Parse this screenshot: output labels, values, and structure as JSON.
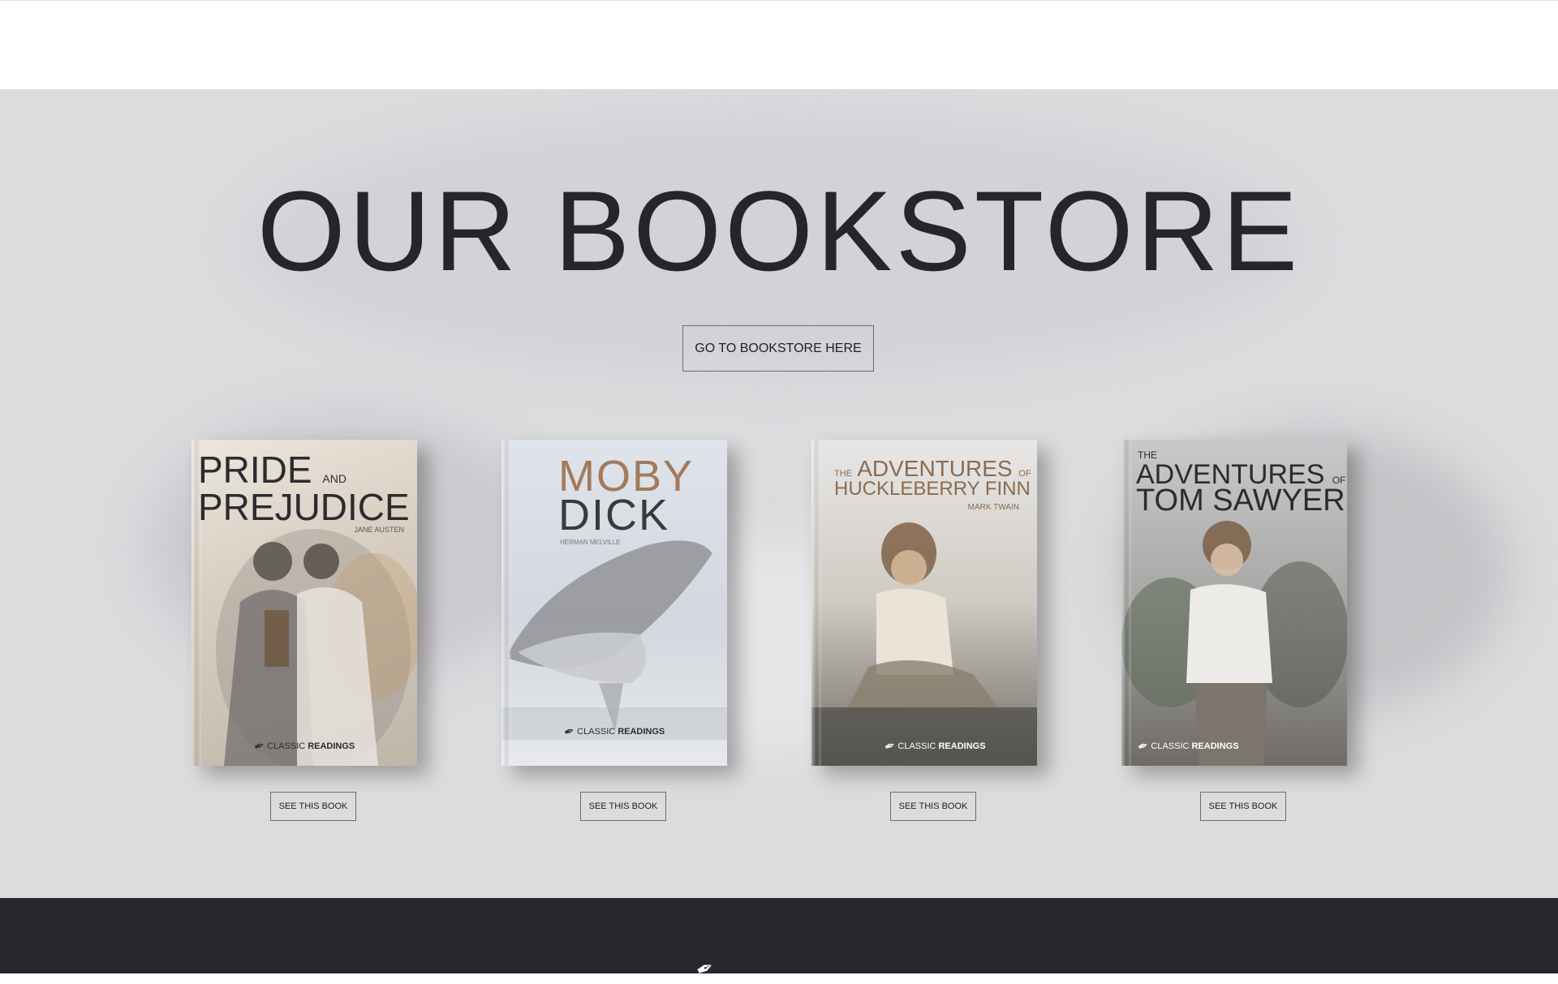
{
  "section": {
    "title": "OUR BOOKSTORE",
    "store_button": "GO TO BOOKSTORE HERE"
  },
  "books": [
    {
      "title_line1": "PRIDE",
      "title_small": "AND",
      "title_line2": "PREJUDICE",
      "author": "JANE AUSTEN",
      "button": "SEE THIS BOOK",
      "logo_light": "CLASSIC",
      "logo_bold": "READINGS"
    },
    {
      "title_line1": "MOBY",
      "title_line2": "DICK",
      "author": "HERMAN MELVILLE",
      "button": "SEE THIS BOOK",
      "logo_light": "CLASSIC",
      "logo_bold": "READINGS"
    },
    {
      "title_small": "THE",
      "title_line1": "ADVENTURES",
      "title_small2": "OF",
      "title_line2": "HUCKLEBERRY FINN",
      "author": "MARK TWAIN",
      "button": "SEE THIS BOOK",
      "logo_light": "CLASSIC",
      "logo_bold": "READINGS"
    },
    {
      "title_small": "THE",
      "title_line1": "ADVENTURES",
      "title_small2": "OF",
      "title_line2": "TOM SAWYER",
      "button": "SEE THIS BOOK",
      "logo_light": "CLASSIC",
      "logo_bold": "READINGS"
    }
  ],
  "colors": {
    "section_bg": "#dcdbde",
    "footer_bg": "#28272b",
    "title": "#26252a",
    "moby_accent": "#a27a5c",
    "huck_accent": "#8d6a4f"
  },
  "icons": {
    "logo_feather": "feather-icon"
  }
}
